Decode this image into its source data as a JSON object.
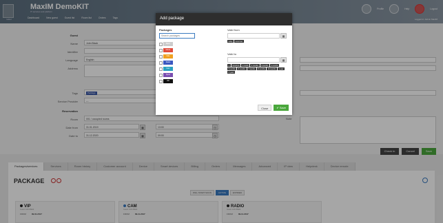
{
  "header": {
    "app_title": "MaxIM DemoKIT",
    "app_subtitle": "IT services and platform",
    "logo_label": "Hotel",
    "nav": [
      "Dashboard",
      "New guest",
      "Guest list",
      "Room list",
      "Orders",
      "Tags"
    ],
    "right_labels": [
      "Profile",
      "Help",
      "Logout"
    ],
    "user_line": "Logged in: Admin MaxIM"
  },
  "form": {
    "section_guest": "Guest",
    "name_label": "Name",
    "name_value": "John Black",
    "identifier_label": "Identifier",
    "language_label": "Language",
    "language_value": "English",
    "address_label": "Address",
    "tags_label": "Tags",
    "tag_value": "Package",
    "service_provider_label": "Service Provider",
    "service_provider_value": "---",
    "section_reservation": "Reservation",
    "room_label": "Room",
    "room_value": "001 / occupied rooms",
    "date_from_label": "Date from",
    "date_from_value": "31.01.2019",
    "time_from_value": "13:00",
    "date_to_label": "Date to",
    "date_to_value": "31.12.2020",
    "time_to_value": "09:00",
    "note_label": "Note",
    "calendar_icon": "calendar-icon",
    "clock_icon": "clock-icon"
  },
  "actions": {
    "check_in": "Check In",
    "cancel": "Cancel",
    "save": "Save"
  },
  "tabs": [
    "Packages/services",
    "Services",
    "Room history",
    "Customer account",
    "Device",
    "Smart devices",
    "Billing",
    "Orders",
    "Messages",
    "Advanced",
    "IP view",
    "Helpdesk",
    "Device remote"
  ],
  "packages": {
    "title": "PACKAGE",
    "filters": [
      "WILL START SOON",
      "ACTIVE",
      "EXPIRED"
    ],
    "active_filter": "ACTIVE",
    "cards": [
      {
        "name": "VIP",
        "sub": "Guest: John Black",
        "from_label": "FROM",
        "from_date": "09.01.2017",
        "dot_color": "#222222"
      },
      {
        "name": "CAM",
        "sub": "Guest: John Black",
        "from_label": "FROM",
        "from_date": "09.11.2017",
        "dot_color": "#3a7ac0"
      },
      {
        "name": "RADIO",
        "sub": "Guest: John Black",
        "from_label": "FROM",
        "from_date": "09.11.2017",
        "dot_color": "#222222"
      }
    ]
  },
  "modal": {
    "title": "Add package",
    "packages_label": "Packages",
    "search_placeholder": "Search packages",
    "package_items": [
      {
        "label": "Basic",
        "color": "#cccccc"
      },
      {
        "label": "Movie",
        "color": "#e04a3a"
      },
      {
        "label": "Kids",
        "color": "#f0a020"
      },
      {
        "label": "Radio",
        "color": "#3a57c0"
      },
      {
        "label": "Cam",
        "color": "#2aa0c0"
      },
      {
        "label": "Sport",
        "color": "#7a4fb0"
      },
      {
        "label": "VIP",
        "color": "#111111"
      }
    ],
    "valid_from_label": "Valid from",
    "valid_from_quick": [
      "today",
      "tomorrow"
    ],
    "valid_to_label": "Valid to",
    "valid_to_quick": [
      "∞",
      "tomorrow",
      "1 month",
      "2 months",
      "3 months",
      "4 months",
      "5 months",
      "6 months",
      "7 months",
      "8 months",
      "10 months",
      "1 year",
      "2 years"
    ],
    "close_label": "Close",
    "save_label": "Save"
  },
  "colors": {
    "accent": "#3a7ac0",
    "save_green": "#4aa73c",
    "modal_header": "#2e2e2e"
  }
}
